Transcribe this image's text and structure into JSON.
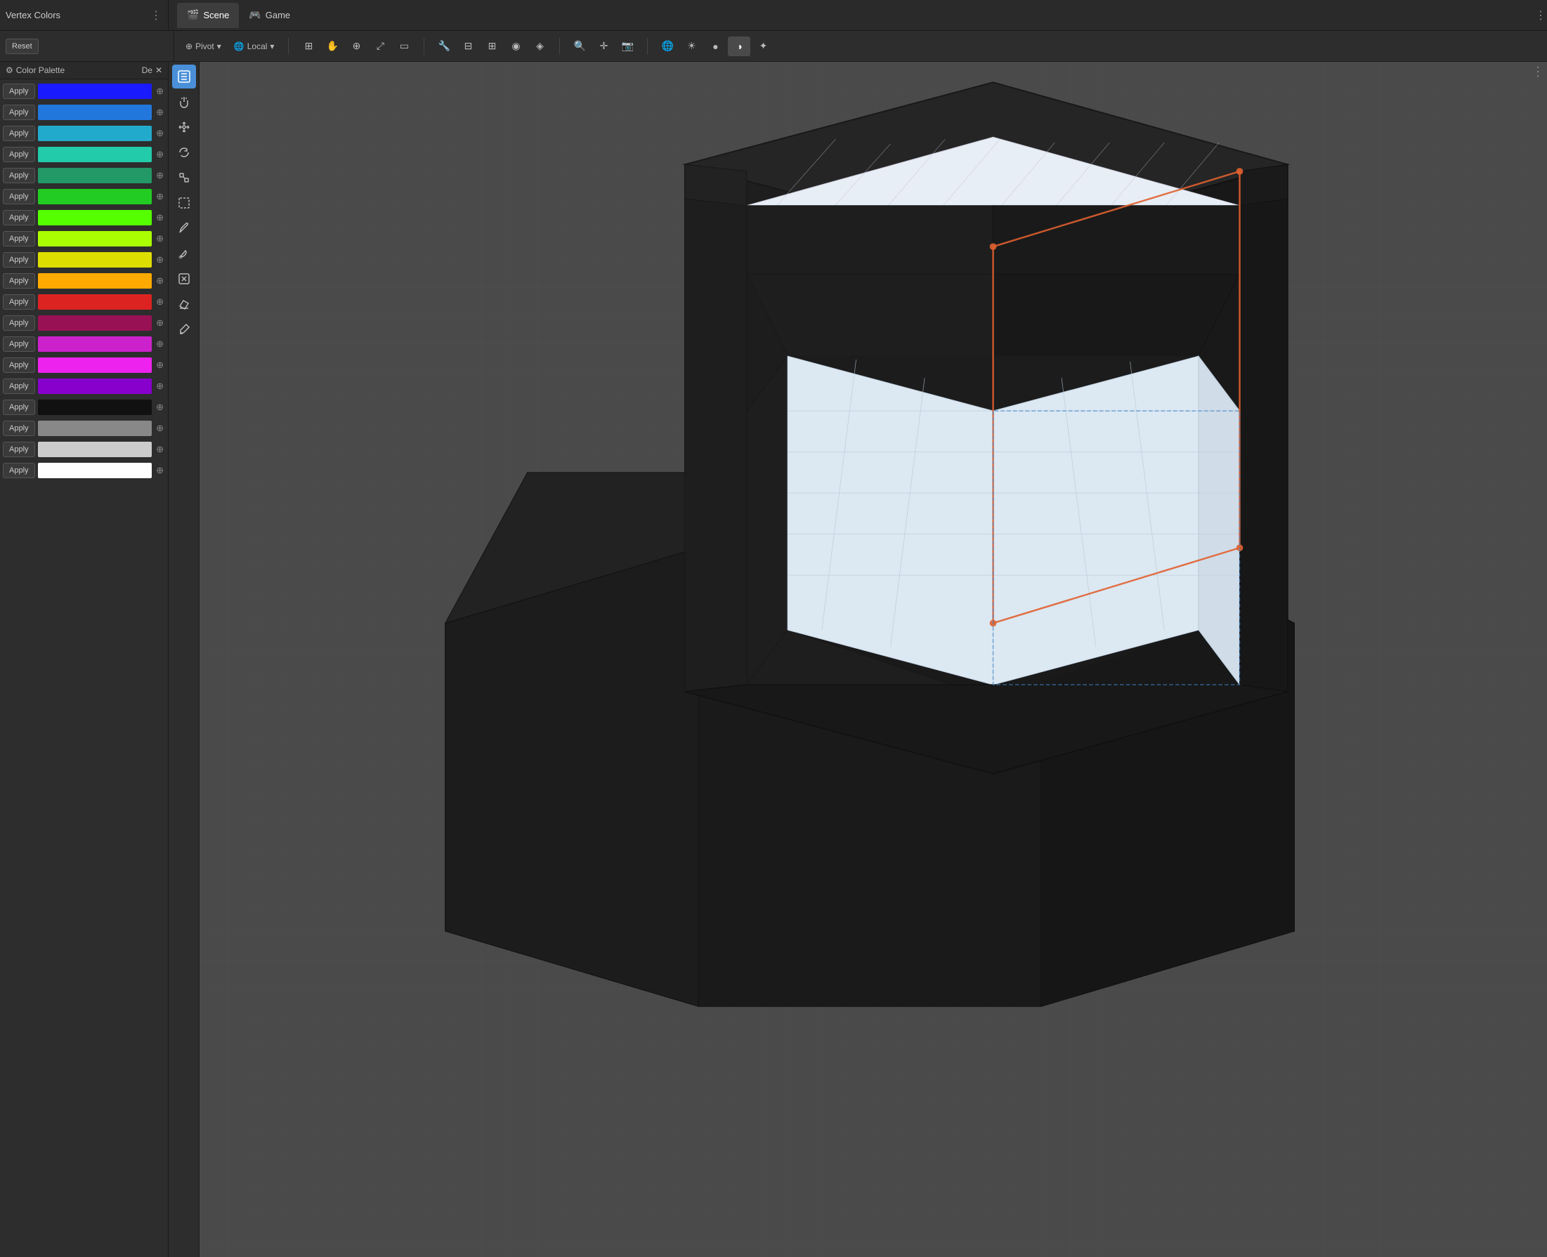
{
  "panel": {
    "title": "Vertex Colors",
    "reset_label": "Reset",
    "menu_icon": "⋮",
    "color_palette_label": "Color Palette",
    "de_icon": "De",
    "settings_icon": "⚙"
  },
  "colors": [
    {
      "id": 1,
      "hex": "#1a1aff",
      "apply": "Apply"
    },
    {
      "id": 2,
      "hex": "#2277dd",
      "apply": "Apply"
    },
    {
      "id": 3,
      "hex": "#22aacc",
      "apply": "Apply"
    },
    {
      "id": 4,
      "hex": "#22ccaa",
      "apply": "Apply"
    },
    {
      "id": 5,
      "hex": "#229966",
      "apply": "Apply"
    },
    {
      "id": 6,
      "hex": "#22cc22",
      "apply": "Apply"
    },
    {
      "id": 7,
      "hex": "#55ff00",
      "apply": "Apply"
    },
    {
      "id": 8,
      "hex": "#aaff00",
      "apply": "Apply"
    },
    {
      "id": 9,
      "hex": "#dddd00",
      "apply": "Apply"
    },
    {
      "id": 10,
      "hex": "#ffaa00",
      "apply": "Apply"
    },
    {
      "id": 11,
      "hex": "#dd2222",
      "apply": "Apply"
    },
    {
      "id": 12,
      "hex": "#991155",
      "apply": "Apply"
    },
    {
      "id": 13,
      "hex": "#cc22cc",
      "apply": "Apply"
    },
    {
      "id": 14,
      "hex": "#ee22ee",
      "apply": "Apply"
    },
    {
      "id": 15,
      "hex": "#8800cc",
      "apply": "Apply"
    },
    {
      "id": 16,
      "hex": "#111111",
      "apply": "Apply"
    },
    {
      "id": 17,
      "hex": "#888888",
      "apply": "Apply"
    },
    {
      "id": 18,
      "hex": "#cccccc",
      "apply": "Apply"
    },
    {
      "id": 19,
      "hex": "#ffffff",
      "apply": "Apply"
    }
  ],
  "tabs": [
    {
      "id": "scene",
      "label": "Scene",
      "icon": "🎬",
      "active": true
    },
    {
      "id": "game",
      "label": "Game",
      "icon": "🎮",
      "active": false
    }
  ],
  "toolbar": {
    "pivot_label": "Pivot",
    "local_label": "Local",
    "pivot_chevron": "▾",
    "local_chevron": "▾"
  },
  "topbar_menu": "⋮",
  "viewport_menu": "⋮"
}
